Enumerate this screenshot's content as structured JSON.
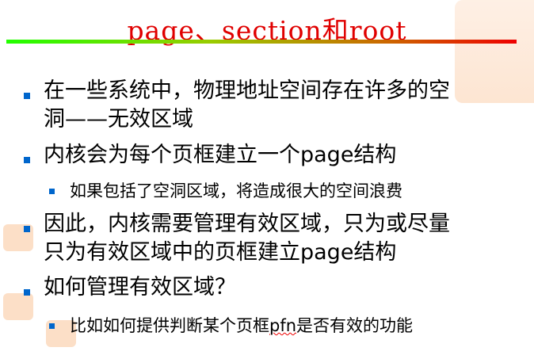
{
  "slide": {
    "title": "page、section和root",
    "bullets": [
      {
        "text": "在一些系统中，物理地址空间存在许多的空",
        "text2": "洞——无效区域"
      },
      {
        "text": "内核会为每个页框建立一个page结构",
        "sub": "如果包括了空洞区域，将造成很大的空间浪费"
      },
      {
        "text": "因此，内核需要管理有效区域，只为或尽量",
        "text2": "只为有效区域中的页框建立page结构"
      },
      {
        "text": "如何管理有效区域？",
        "sub_pre": "比如如何提供判断某个页框",
        "sub_word": "pfn",
        "sub_post": "是否有效的功能"
      }
    ]
  },
  "colors": {
    "title": "#e00000",
    "bullet": "#0066cc"
  }
}
